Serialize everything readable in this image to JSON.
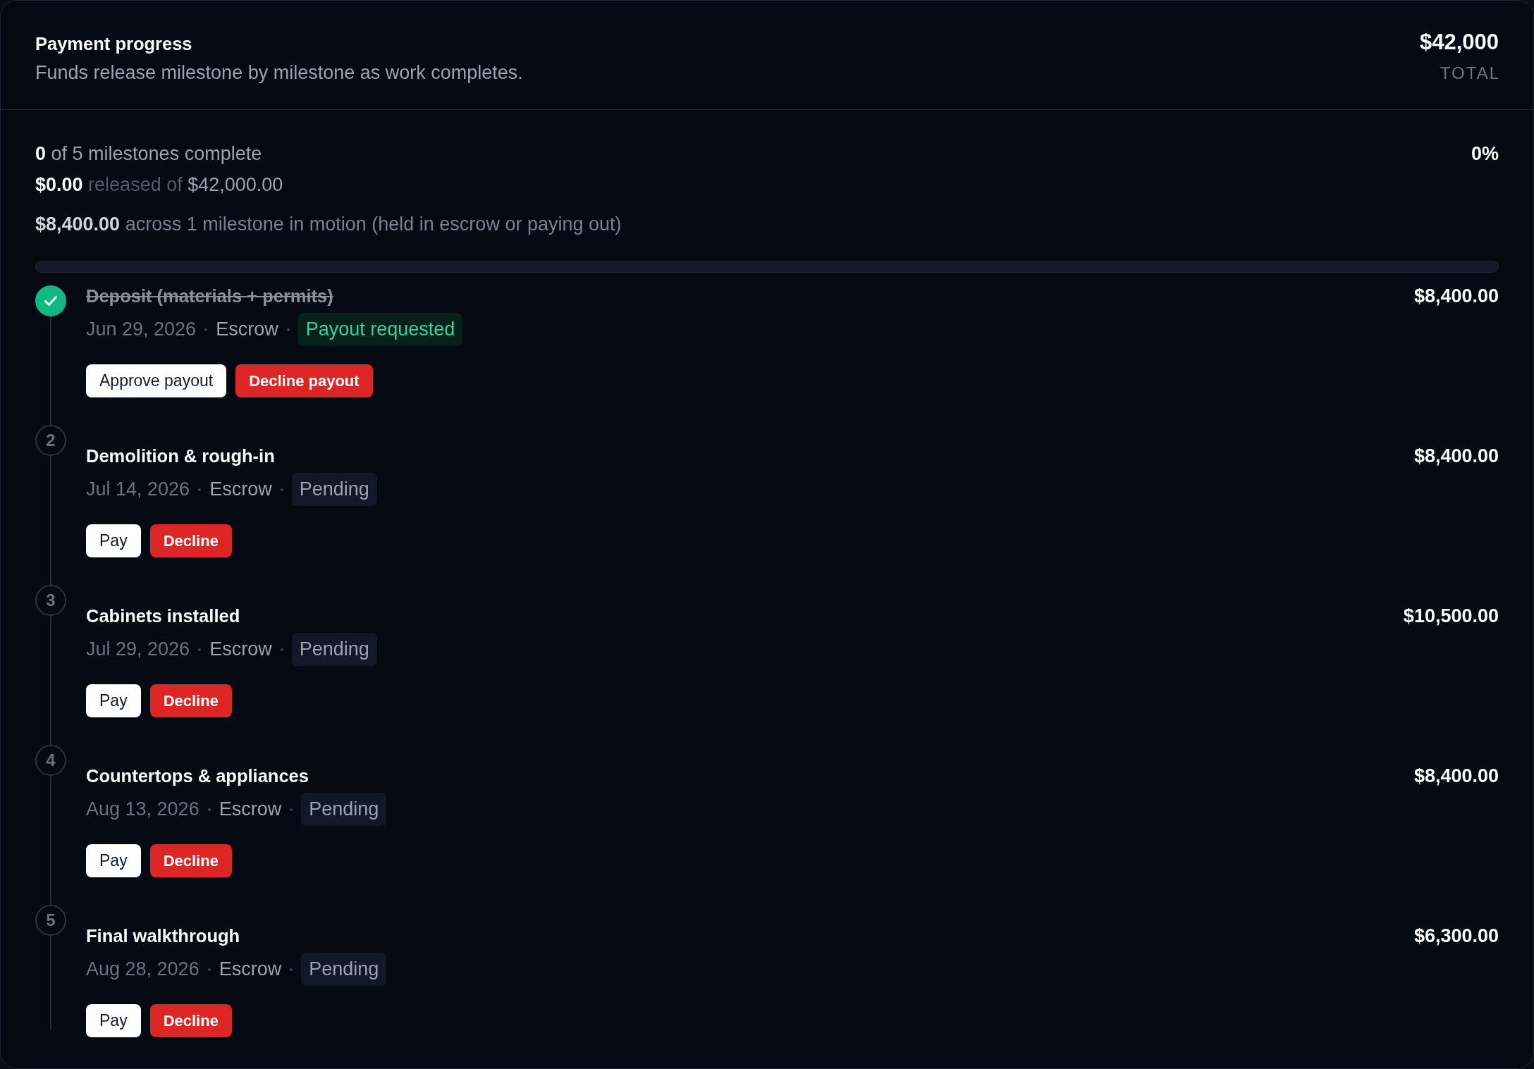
{
  "header": {
    "title": "Payment progress",
    "subtitle": "Funds release milestone by milestone as work completes.",
    "total": "$42,000",
    "total_caption": "TOTAL"
  },
  "summary": {
    "completed": {
      "count": "0",
      "text": "of 5 milestones complete"
    },
    "released": {
      "amount": "$0.00",
      "text": "released of",
      "total": "$42,000.00"
    },
    "in_motion": {
      "amount": "$8,400.00",
      "text": "across 1 milestone in motion (held in escrow or paying out)"
    },
    "percent": "0%"
  },
  "progress": {
    "level": 0
  },
  "milestones": [
    {
      "done": true,
      "title": "Deposit (materials + permits)",
      "amount": "$8,400.00",
      "date": "Jun 29, 2026",
      "method": "Escrow",
      "status": {
        "label": "Payout requested",
        "kind": "requested"
      },
      "actions": [
        {
          "label": "Approve payout",
          "kind": "approve"
        },
        {
          "label": "Decline payout",
          "kind": "decline"
        }
      ]
    },
    {
      "done": false,
      "step": "2",
      "title": "Demolition & rough-in",
      "amount": "$8,400.00",
      "date": "Jul 14, 2026",
      "method": "Escrow",
      "status": {
        "label": "Pending",
        "kind": "pending"
      },
      "actions": [
        {
          "label": "Pay",
          "kind": "approve"
        },
        {
          "label": "Decline",
          "kind": "decline"
        }
      ]
    },
    {
      "done": false,
      "step": "3",
      "title": "Cabinets installed",
      "amount": "$10,500.00",
      "date": "Jul 29, 2026",
      "method": "Escrow",
      "status": {
        "label": "Pending",
        "kind": "pending"
      },
      "actions": [
        {
          "label": "Pay",
          "kind": "approve"
        },
        {
          "label": "Decline",
          "kind": "decline"
        }
      ]
    },
    {
      "done": false,
      "step": "4",
      "title": "Countertops & appliances",
      "amount": "$8,400.00",
      "date": "Aug 13, 2026",
      "method": "Escrow",
      "status": {
        "label": "Pending",
        "kind": "pending"
      },
      "actions": [
        {
          "label": "Pay",
          "kind": "approve"
        },
        {
          "label": "Decline",
          "kind": "decline"
        }
      ]
    },
    {
      "done": false,
      "step": "5",
      "title": "Final walkthrough",
      "amount": "$6,300.00",
      "date": "Aug 28, 2026",
      "method": "Escrow",
      "status": {
        "label": "Pending",
        "kind": "pending"
      },
      "actions": [
        {
          "label": "Pay",
          "kind": "approve"
        },
        {
          "label": "Decline",
          "kind": "decline"
        }
      ]
    }
  ]
}
